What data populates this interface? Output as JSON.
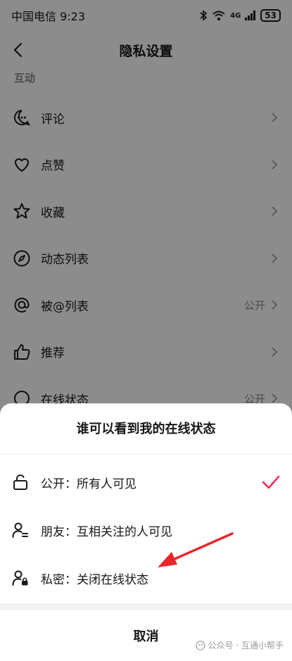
{
  "status_bar": {
    "carrier_time": "中国电信 9:23",
    "network": "4G",
    "battery": "53"
  },
  "nav": {
    "title": "隐私设置"
  },
  "section": {
    "label": "互动"
  },
  "rows": [
    {
      "label": "评论",
      "value": "",
      "icon": "comment-icon"
    },
    {
      "label": "点赞",
      "value": "",
      "icon": "heart-icon"
    },
    {
      "label": "收藏",
      "value": "",
      "icon": "star-icon"
    },
    {
      "label": "动态列表",
      "value": "",
      "icon": "compass-icon"
    },
    {
      "label": "被@列表",
      "value": "公开",
      "icon": "at-icon"
    },
    {
      "label": "推荐",
      "value": "",
      "icon": "thumbs-up-icon"
    },
    {
      "label": "在线状态",
      "value": "公开",
      "icon": "online-icon"
    }
  ],
  "sheet": {
    "title": "谁可以看到我的在线状态",
    "options": [
      {
        "label": "公开：所有人可见",
        "selected": true,
        "icon": "unlock-icon"
      },
      {
        "label": "朋友：互相关注的人可见",
        "selected": false,
        "icon": "friends-icon"
      },
      {
        "label": "私密：关闭在线状态",
        "selected": false,
        "icon": "private-user-icon"
      }
    ],
    "cancel": "取消"
  },
  "watermark": {
    "text": "公众号 · 互通小帮手"
  },
  "colors": {
    "check": "#fe2c55",
    "arrow": "#e8262b"
  }
}
